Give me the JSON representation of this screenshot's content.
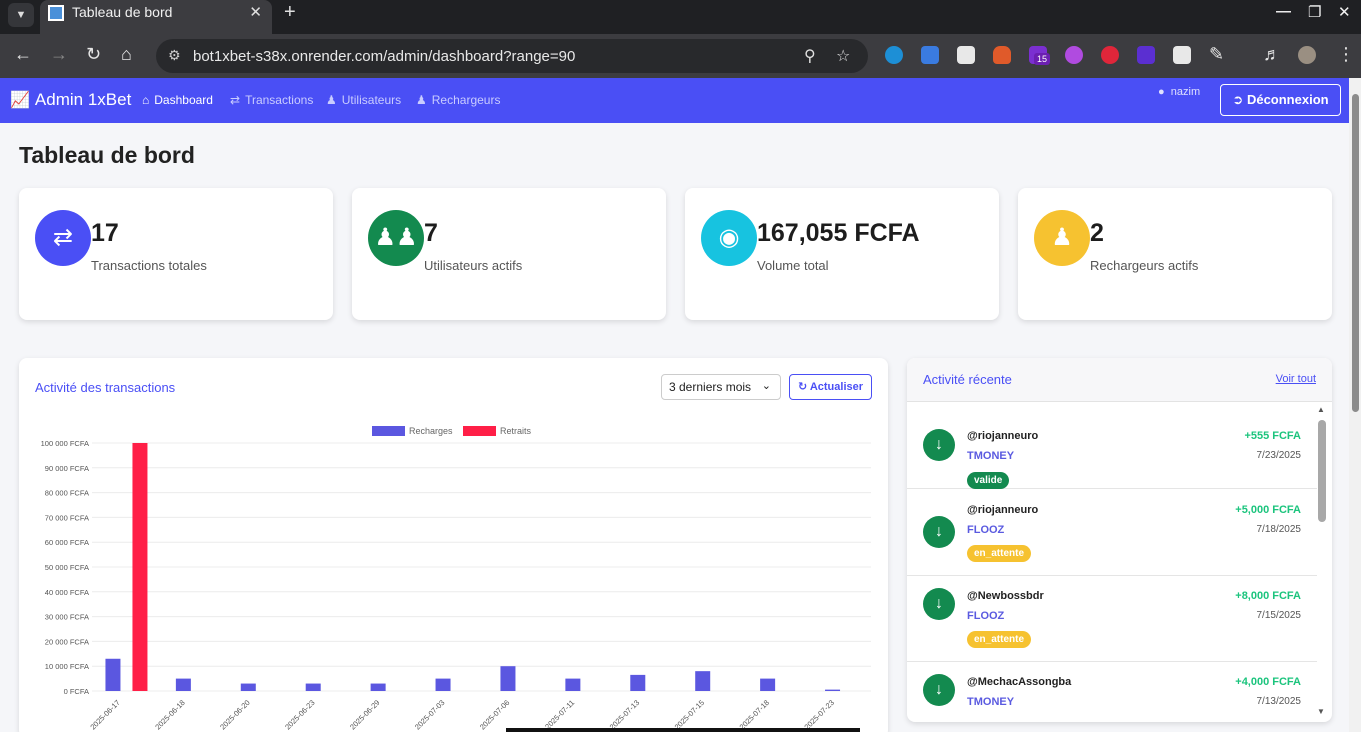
{
  "browser": {
    "tab_title": "Tableau de bord",
    "url": "bot1xbet-s38x.onrender.com/admin/dashboard?range=90",
    "extension_badge": "15"
  },
  "navbar": {
    "brand": "Admin 1xBet",
    "links": [
      {
        "label": "Dashboard",
        "icon": "home-icon",
        "active": true
      },
      {
        "label": "Transactions",
        "icon": "exchange-icon",
        "active": false
      },
      {
        "label": "Utilisateurs",
        "icon": "users-icon",
        "active": false
      },
      {
        "label": "Rechargeurs",
        "icon": "user-icon",
        "active": false
      }
    ],
    "username": "nazim",
    "logout_label": "Déconnexion"
  },
  "page_title": "Tableau de bord",
  "stats": [
    {
      "value": "17",
      "label": "Transactions totales",
      "icon": "exchange-icon",
      "color": "#4a4ff5"
    },
    {
      "value": "7",
      "label": "Utilisateurs actifs",
      "icon": "users-icon",
      "color": "#138a4f"
    },
    {
      "value": "167,055 FCFA",
      "label": "Volume total",
      "icon": "coins-icon",
      "color": "#17c3e0"
    },
    {
      "value": "2",
      "label": "Rechargeurs actifs",
      "icon": "person-tie-icon",
      "color": "#f6c230"
    }
  ],
  "chart_panel": {
    "title": "Activité des transactions",
    "range_selected": "3 derniers mois",
    "refresh_label": "Actualiser"
  },
  "chart_data": {
    "type": "bar",
    "categories": [
      "2025-06-17",
      "2025-06-18",
      "2025-06-20",
      "2025-06-23",
      "2025-06-29",
      "2025-07-03",
      "2025-07-06",
      "2025-07-11",
      "2025-07-13",
      "2025-07-15",
      "2025-07-18",
      "2025-07-23"
    ],
    "series": [
      {
        "name": "Recharges",
        "color": "#5b57e0",
        "values": [
          13000,
          5000,
          3000,
          3000,
          3000,
          5000,
          10000,
          5000,
          6500,
          8000,
          5000,
          555
        ]
      },
      {
        "name": "Retraits",
        "color": "#ff1f47",
        "values": [
          100000,
          0,
          0,
          0,
          0,
          0,
          0,
          0,
          0,
          0,
          0,
          0
        ]
      }
    ],
    "ylim": [
      0,
      100000
    ],
    "yticks": [
      "0 FCFA",
      "10 000 FCFA",
      "20 000 FCFA",
      "30 000 FCFA",
      "40 000 FCFA",
      "50 000 FCFA",
      "60 000 FCFA",
      "70 000 FCFA",
      "80 000 FCFA",
      "90 000 FCFA",
      "100 000 FCFA"
    ],
    "legend_position": "top",
    "grid": true
  },
  "activity": {
    "title": "Activité récente",
    "see_all": "Voir tout",
    "items": [
      {
        "user": "@riojanneuro",
        "method": "TMONEY",
        "amount": "+555 FCFA",
        "date": "7/23/2025",
        "status": "valide"
      },
      {
        "user": "@riojanneuro",
        "method": "FLOOZ",
        "amount": "+5,000 FCFA",
        "date": "7/18/2025",
        "status": "en_attente"
      },
      {
        "user": "@Newbossbdr",
        "method": "FLOOZ",
        "amount": "+8,000 FCFA",
        "date": "7/15/2025",
        "status": "en_attente"
      },
      {
        "user": "@MechacAssongba",
        "method": "TMONEY",
        "amount": "+4,000 FCFA",
        "date": "7/13/2025",
        "status": ""
      }
    ]
  }
}
